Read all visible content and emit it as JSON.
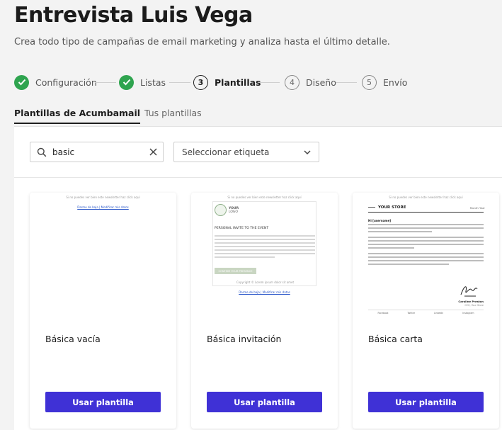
{
  "page": {
    "title": "Entrevista Luis Vega",
    "subtitle": "Crea todo tipo de campañas de email marketing y analiza hasta el último detalle."
  },
  "stepper": {
    "steps": [
      {
        "number": "",
        "label": "Configuración",
        "state": "done"
      },
      {
        "number": "",
        "label": "Listas",
        "state": "done"
      },
      {
        "number": "3",
        "label": "Plantillas",
        "state": "current"
      },
      {
        "number": "4",
        "label": "Diseño",
        "state": "todo"
      },
      {
        "number": "5",
        "label": "Envío",
        "state": "todo"
      }
    ]
  },
  "tabs": {
    "acumbamail": "Plantillas de Acumbamail",
    "mine": "Tus plantillas"
  },
  "filters": {
    "search_value": "basic",
    "tag_placeholder": "Seleccionar etiqueta"
  },
  "cards": [
    {
      "name": "Básica vacía",
      "button": "Usar plantilla"
    },
    {
      "name": "Básica invitación",
      "button": "Usar plantilla"
    },
    {
      "name": "Básica carta",
      "button": "Usar plantilla"
    }
  ],
  "previews": {
    "browser_note": "Si no puedes ver bien este newsletter haz click aquí",
    "footer_links": "Darme de baja | Modificar mis datos",
    "logo_word": "YOUR",
    "logo_sub": "LOGO",
    "invite_heading": "PERSONAL INVITE TO THE EVENT",
    "invite_button": "CONFIRM YOUR PRESENCE",
    "invite_footer": "Copyright © Lorem ipsum dolor sit amet",
    "store_name": "YOUR STORE",
    "store_menu": "Month Year",
    "greeting": "Hi [username]",
    "sign_name": "Caroline Preston",
    "sign_role": "CEO, Your Store",
    "footer_cols": [
      "Facebook",
      "Twitter",
      "Linkedin",
      "Instagram"
    ]
  },
  "colors": {
    "accent_button": "#3f31d6",
    "step_done": "#2fa44f",
    "invite_button": "#c9d6c2"
  },
  "icons": {
    "step_done": "check-icon",
    "search": "search-icon",
    "clear": "close-icon",
    "dropdown": "chevron-down-icon"
  }
}
